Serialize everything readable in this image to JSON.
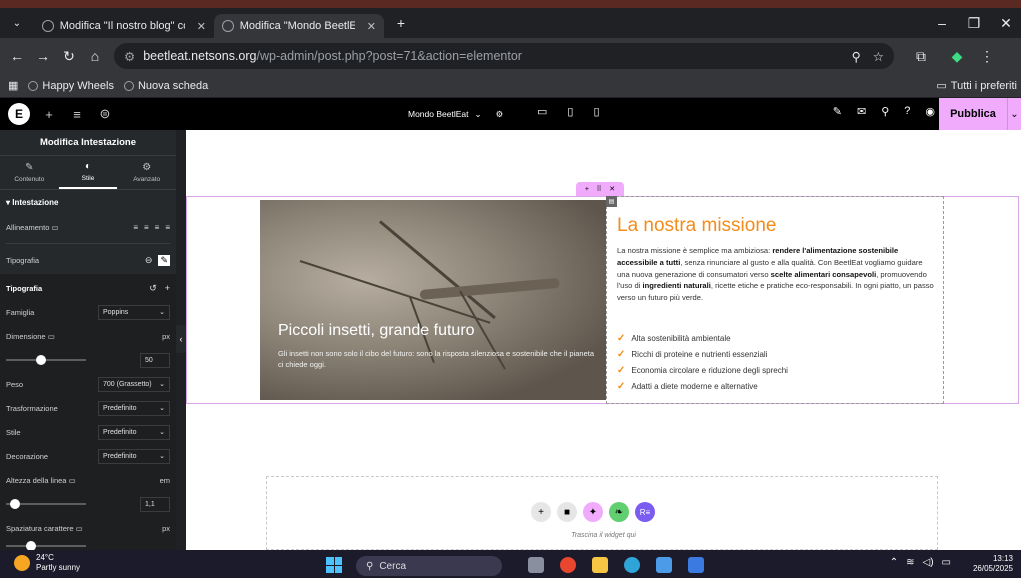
{
  "browser": {
    "tabs": [
      {
        "label": "Modifica \"Il nostro blog\" con El",
        "active": false
      },
      {
        "label": "Modifica \"Mondo BeetlEat\" con",
        "active": true
      }
    ],
    "new_tab": "+",
    "url_host": "beetleat.netsons.org",
    "url_path": "/wp-admin/post.php?post=71&action=elementor",
    "bookmarks": [
      "Happy Wheels",
      "Nuova scheda"
    ],
    "all_bookmarks": "Tutti i preferiti"
  },
  "editor": {
    "page_name": "Mondo BeetlEat",
    "publish": "Pubblica"
  },
  "panel": {
    "title": "Modifica Intestazione",
    "tabs": [
      "Contenuto",
      "Stile",
      "Avanzato"
    ],
    "section": "Intestazione",
    "alignment_label": "Allineamento",
    "typography_label": "Tipografia",
    "typography_sub": "Tipografia",
    "family_label": "Famiglia",
    "family_value": "Poppins",
    "size_label": "Dimensione",
    "size_unit": "px",
    "size_value": "50",
    "weight_label": "Peso",
    "weight_value": "700 (Grassetto)",
    "transform_label": "Trasformazione",
    "transform_value": "Predefinito",
    "style_label": "Stile",
    "style_value": "Predefinito",
    "decoration_label": "Decorazione",
    "decoration_value": "Predefinito",
    "lineheight_label": "Altezza della linea",
    "lineheight_unit": "em",
    "lineheight_value": "1,1",
    "spacing_label": "Spaziatura carattere",
    "spacing_unit": "px"
  },
  "canvas": {
    "hero_title": "Piccoli insetti, grande futuro",
    "hero_sub": "Gli insetti non sono solo il cibo del futuro: sono la risposta silenziosa e sostenibile che il pianeta ci chiede oggi.",
    "mission_title": "La nostra missione",
    "mission_p1": "La nostra missione è semplice ma ambiziosa: ",
    "mission_b1": "rendere l'alimentazione sostenibile accessibile a tutti",
    "mission_p2": ", senza rinunciare al gusto e alla qualità. Con BeetlEat vogliamo guidare una nuova generazione di consumatori verso ",
    "mission_b2": "scelte alimentari consapevoli",
    "mission_p3": ", promuovendo l'uso di ",
    "mission_b3": "ingredienti naturali",
    "mission_p4": ", ricette etiche e pratiche eco-responsabili. In ogni piatto, un passo verso un futuro più verde.",
    "checklist": [
      "Alta sostenibilità ambientale",
      "Ricchi di proteine e nutrienti essenziali",
      "Economia circolare e riduzione degli sprechi",
      "Adatti a diete moderne e alternative"
    ],
    "dropzone_text": "Trascina il widget qui"
  },
  "taskbar": {
    "temp": "24°C",
    "weather": "Partly sunny",
    "search": "Cerca",
    "time": "13:13",
    "date": "26/05/2025"
  },
  "colors": {
    "accent_orange": "#f28c1b",
    "elementor_pink": "#f0abfc"
  }
}
